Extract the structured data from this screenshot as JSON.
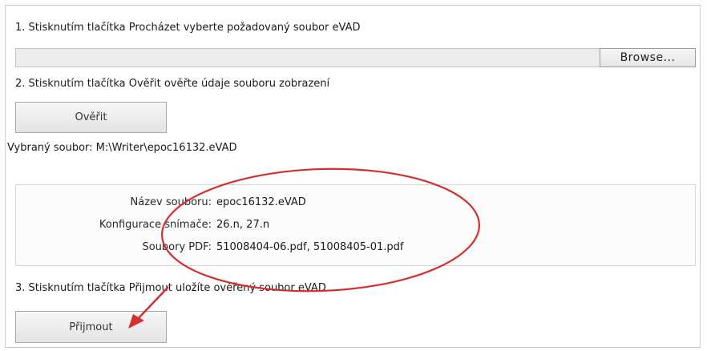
{
  "steps": {
    "step1": "1. Stisknutím tlačítka Procházet vyberte požadovaný soubor eVAD",
    "step2": "2. Stisknutím tlačítka Ověřit ověřte údaje souboru zobrazení",
    "step3": "3. Stisknutím tlačítka Přijmout uložíte ověřený soubor eVAD"
  },
  "file_input": {
    "value": "",
    "browse_label": "Browse..."
  },
  "verify_button": {
    "label": "Ověřit"
  },
  "selected_file": {
    "text": "Vybraný soubor: M:\\Writer\\epoc16132.eVAD"
  },
  "file_info": {
    "rows": [
      {
        "label": "Název souboru:",
        "value": "epoc16132.eVAD"
      },
      {
        "label": "Konfigurace snímače:",
        "value": "26.n, 27.n"
      },
      {
        "label": "Soubory PDF:",
        "value": "51008404-06.pdf, 51008405-01.pdf"
      }
    ]
  },
  "accept_button": {
    "label": "Přijmout"
  },
  "annotation": {
    "ellipse_color": "#d32f2f",
    "arrow_color": "#d32f2f"
  }
}
